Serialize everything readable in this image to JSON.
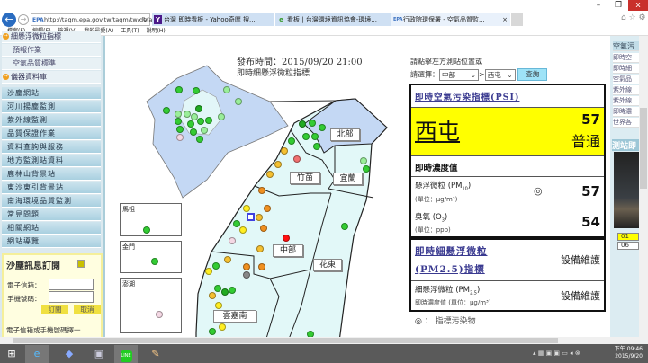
{
  "browser": {
    "url": "http://taqm.epa.gov.tw/taqm/tw/default.aspx",
    "tabs": [
      {
        "label": "台灣 即時看板 - Yahoo奇摩 搜...",
        "icon": "Y"
      },
      {
        "label": "看板 | 台灣環境資訊協會-環境...",
        "icon": "e"
      },
      {
        "label": "行政院環保署 - 空氣品質監...",
        "icon": "EPA",
        "close": "×"
      }
    ],
    "menu": [
      "檔案(F)",
      "編輯(E)",
      "檢視(V)",
      "我的最愛(A)",
      "工具(T)",
      "說明(H)"
    ],
    "window_buttons": {
      "min": "–",
      "max": "❐",
      "close": "x"
    }
  },
  "sidebar": {
    "sub_items": [
      "細懸浮微粒指標",
      "預報作業",
      "空氣品質標準",
      "儀器資料庫"
    ],
    "items": [
      "沙塵網站",
      "河川揚塵監測",
      "紫外線監測",
      "品質保證作業",
      "資料查詢與服務",
      "地方監測站資料",
      "鹿林山背景站",
      "東沙東引背景站",
      "南海環境品質監測",
      "常見問題",
      "相關網站",
      "網站導覽"
    ],
    "subscribe": {
      "title": "沙塵訊息訂閱",
      "email_label": "電子信箱：",
      "phone_label": "手機號碼：",
      "subscribe": "訂閱",
      "cancel": "取消",
      "note": "電子信箱或手機號碼擇一"
    }
  },
  "map": {
    "publish_time": "發布時間：2015/09/20 21:00",
    "title": "即時細懸浮微粒指標",
    "regions": [
      "北部",
      "竹苗",
      "宜蘭",
      "中部",
      "花東",
      "雲嘉南"
    ],
    "insets": [
      "馬祖",
      "金門",
      "澎湖"
    ],
    "colors": {
      "good": "#33cc33",
      "good_light": "#99ee99",
      "good_dark": "#22aa22",
      "moderate": "#ffee22",
      "moderate2": "#f5c030",
      "orange": "#f09020",
      "red": "#ff1010",
      "pink": "#f07070",
      "gray": "#888888",
      "offline": "#f4d8e4"
    }
  },
  "panel": {
    "hint": "請點擊左方測站位置或",
    "select_label": "請選擇：",
    "region_select": "中部",
    "sep": ">",
    "station_select": "西屯",
    "query": "查詢",
    "psi_title": "即時空氣污染指標(PSI)",
    "station": "西屯",
    "psi_value": "57",
    "psi_status": "普通",
    "psi_color": "#ffff00",
    "conc_title": "即時濃度值",
    "pm10": {
      "label": "懸浮微粒 (PM",
      "sub": "10",
      "close": ")",
      "unit": "(單位：μg/m³)",
      "value": "57",
      "marker": "◎"
    },
    "o3": {
      "label": "臭氧 (O",
      "sub": "3",
      "close": ")",
      "unit": "(單位：ppb)",
      "value": "54"
    },
    "pm25_title1": "即時細懸浮微粒",
    "pm25_title2": "(PM2.5)指標",
    "pm25_status": "設備維護",
    "pm25": {
      "label": "細懸浮微粒 (PM",
      "sub": "2.5",
      "close": ")",
      "unit": "即時濃度值 (單位：μg/m³)",
      "value": "設備維護"
    },
    "legend_icon": "◎",
    "legend": "：  指標污染物"
  },
  "right_panel": {
    "header": "空氣污",
    "items": [
      "即時空",
      "即時細",
      "空氣品",
      "紫外線",
      "紫外線",
      "即時濃",
      "世界各"
    ],
    "camera_title": "測站即",
    "badges": [
      "01",
      "06"
    ]
  },
  "taskbar": {
    "time": "下午 09:46",
    "date": "2015/9/20"
  }
}
